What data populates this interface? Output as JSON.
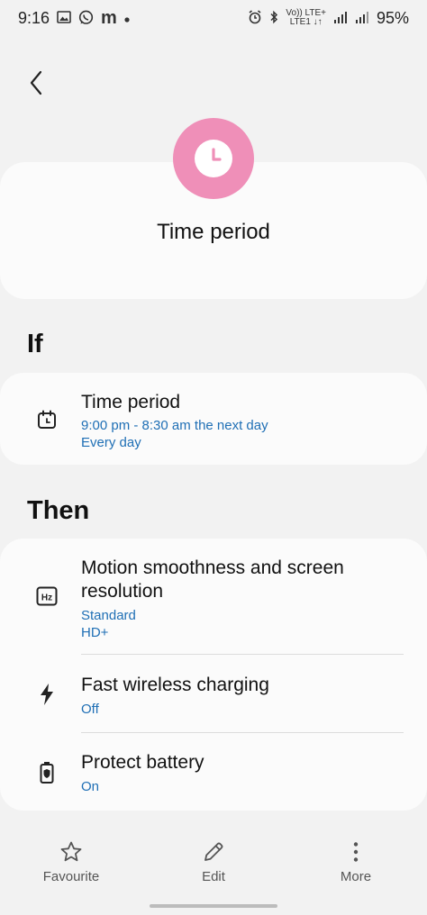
{
  "status_bar": {
    "time": "9:16",
    "notification_icons": [
      "gallery-icon",
      "whatsapp-icon",
      "m-app-icon",
      "dot-icon"
    ],
    "m_glyph": "m",
    "network_top": "Vo)) LTE+",
    "network_bottom": "LTE1 ↓↑",
    "battery": "95%"
  },
  "header": {
    "back_icon": "chevron-left-icon",
    "hero_icon": "clock-icon",
    "hero_color": "#ef8fb8",
    "title": "Time period"
  },
  "if_section": {
    "title": "If",
    "condition": {
      "icon": "calendar-icon",
      "title": "Time period",
      "subtitle": "9:00 pm - 8:30 am the next day",
      "subtitle2": "Every day"
    }
  },
  "then_section": {
    "title": "Then",
    "actions": [
      {
        "icon": "hz-icon",
        "title_line1": "Motion smoothness and screen",
        "title_line2": "resolution",
        "sub1": "Standard",
        "sub2": "HD+"
      },
      {
        "icon": "lightning-icon",
        "title": "Fast wireless charging",
        "sub": "Off"
      },
      {
        "icon": "battery-shield-icon",
        "title": "Protect battery",
        "sub": "On"
      }
    ]
  },
  "bottom_nav": {
    "items": [
      {
        "icon": "star-icon",
        "label": "Favourite"
      },
      {
        "icon": "pencil-icon",
        "label": "Edit"
      },
      {
        "icon": "more-vertical-icon",
        "label": "More"
      }
    ]
  },
  "colors": {
    "accent_text": "#1f6fb5",
    "background": "#f2f2f2",
    "card": "#fbfbfb"
  }
}
